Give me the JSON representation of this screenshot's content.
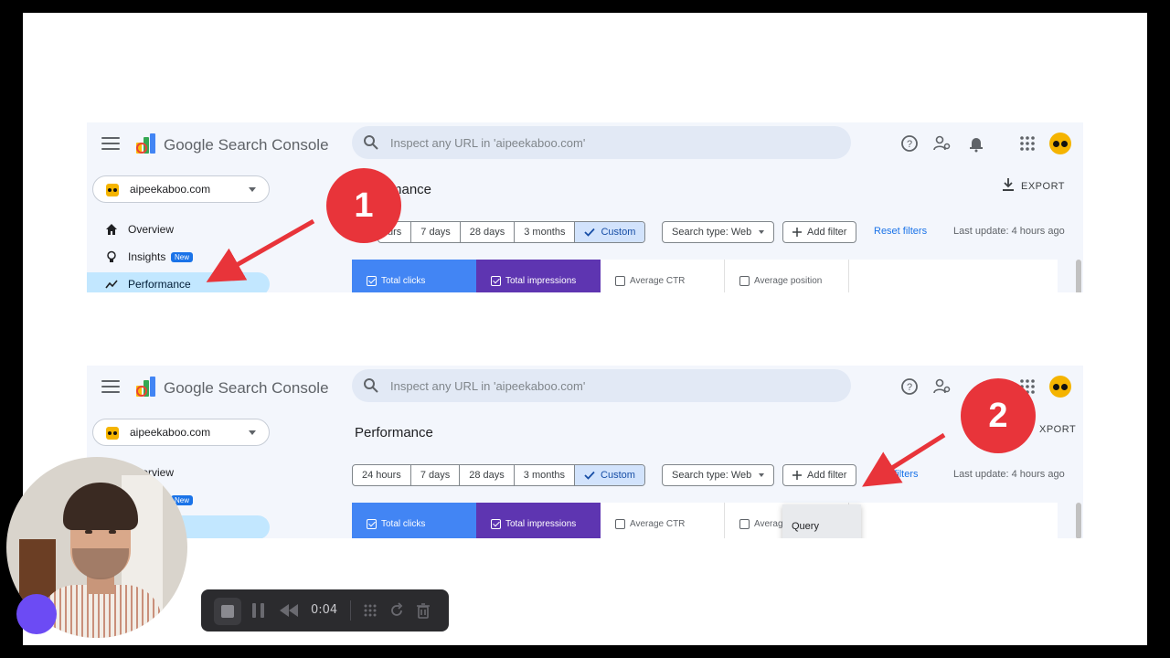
{
  "app": {
    "brand_google": "Google",
    "brand_product": "Search Console"
  },
  "search": {
    "placeholder": "Inspect any URL in 'aipeekaboo.com'"
  },
  "property": {
    "name": "aipeekaboo.com"
  },
  "nav": {
    "overview": "Overview",
    "insights": "Insights",
    "insights_badge": "New",
    "performance": "Performance"
  },
  "page": {
    "title_partial": "mance",
    "title": "Performance",
    "export_label": "EXPORT",
    "export_label_partial": "XPORT"
  },
  "date_ranges": {
    "h24": "24 hours",
    "h24_partial": "urs",
    "d7": "7 days",
    "d28": "28 days",
    "m3": "3 months",
    "custom": "Custom"
  },
  "filters": {
    "search_type": "Search type: Web",
    "add_filter": "Add filter",
    "reset": "Reset filters",
    "reset_partial": "et filters",
    "last_update": "Last update: 4 hours ago"
  },
  "metrics": {
    "clicks": "Total clicks",
    "impressions": "Total impressions",
    "ctr": "Average CTR",
    "position": "Average position",
    "position_partial": "Averag"
  },
  "dropdown": {
    "query": "Query"
  },
  "callouts": {
    "one": "1",
    "two": "2"
  },
  "recorder": {
    "elapsed": "0:04"
  },
  "colors": {
    "accent_blue": "#1a73e8",
    "clicks_blue": "#4285f4",
    "impressions_purple": "#5e35b1",
    "callout_red": "#e8343a"
  }
}
